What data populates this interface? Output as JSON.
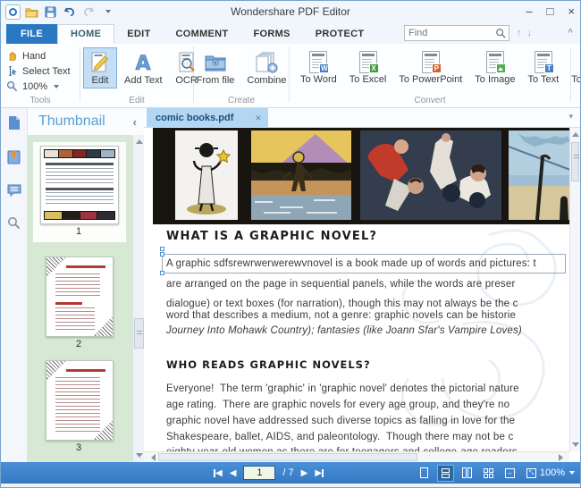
{
  "window": {
    "title": "Wondershare PDF Editor",
    "controls": {
      "minimize": "–",
      "maximize": "□",
      "close": "×"
    }
  },
  "ribbon": {
    "tabs": [
      "FILE",
      "HOME",
      "EDIT",
      "COMMENT",
      "FORMS",
      "PROTECT"
    ],
    "active_tab": "HOME",
    "find_placeholder": "Find",
    "find_prev": "↑",
    "find_next": "↓",
    "collapse": "^"
  },
  "toolbar": {
    "tools": {
      "label": "Tools",
      "items": [
        {
          "label": "Hand"
        },
        {
          "label": "Select Text"
        },
        {
          "label": "100%"
        }
      ]
    },
    "edit": {
      "label": "Edit",
      "items": [
        {
          "label": "Edit",
          "selected": true
        },
        {
          "label": "Add Text"
        },
        {
          "label": "OCR"
        }
      ]
    },
    "create": {
      "label": "Create",
      "items": [
        {
          "label": "From file"
        },
        {
          "label": "Combine"
        }
      ]
    },
    "convert": {
      "label": "Convert",
      "items": [
        {
          "label": "To Word",
          "badge": "W",
          "color": "#4a7fc1"
        },
        {
          "label": "To Excel",
          "badge": "X",
          "color": "#3f9c42"
        },
        {
          "label": "To PowerPoint",
          "badge": "P",
          "color": "#d2622a"
        },
        {
          "label": "To Image",
          "badge": "",
          "color": "#4fae4f"
        },
        {
          "label": "To Text",
          "badge": "T",
          "color": "#4a7fc1"
        },
        {
          "label": "To Other",
          "badge": "",
          "color": "#3f7fd0"
        }
      ]
    }
  },
  "sidebar": {
    "title": "Thumbnail",
    "collapse": "‹",
    "pages": [
      {
        "num": "1"
      },
      {
        "num": "2"
      },
      {
        "num": "3"
      }
    ]
  },
  "tabbar": {
    "doc_tab": "comic books.pdf",
    "close": "×"
  },
  "page": {
    "heading1": "WHAT IS A GRAPHIC NOVEL?",
    "para1": [
      "A graphic sdfsrewrwerwerewvnovel is a book made up of words and pictures: t",
      "are arranged on the page in sequential panels, while the words are preser",
      "dialogue) or text boxes (for narration), though this may not always be the c",
      "word that describes a medium, not a genre: graphic novels can be historie",
      "Journey Into Mohawk Country); fantasies (like Joann Sfar's Vampire Loves)"
    ],
    "heading2": "WHO READS GRAPHIC NOVELS?",
    "para2": [
      "Everyone!  The term 'graphic' in 'graphic novel' denotes the pictorial nature",
      "age rating.  There are graphic novels for every age group, and they're no",
      "graphic novel have addressed such diverse topics as falling in love for the",
      "Shakespeare, ballet, AIDS, and paleontology.  Though there may not be c",
      "eighty year-old women as there are for teenagers and college-age readers,"
    ]
  },
  "statusbar": {
    "page_current": "1",
    "page_total": "/ 7",
    "zoom": "100%",
    "view_modes": [
      "single-page",
      "continuous",
      "facing",
      "quad",
      "fit-width",
      "fit-page"
    ]
  }
}
